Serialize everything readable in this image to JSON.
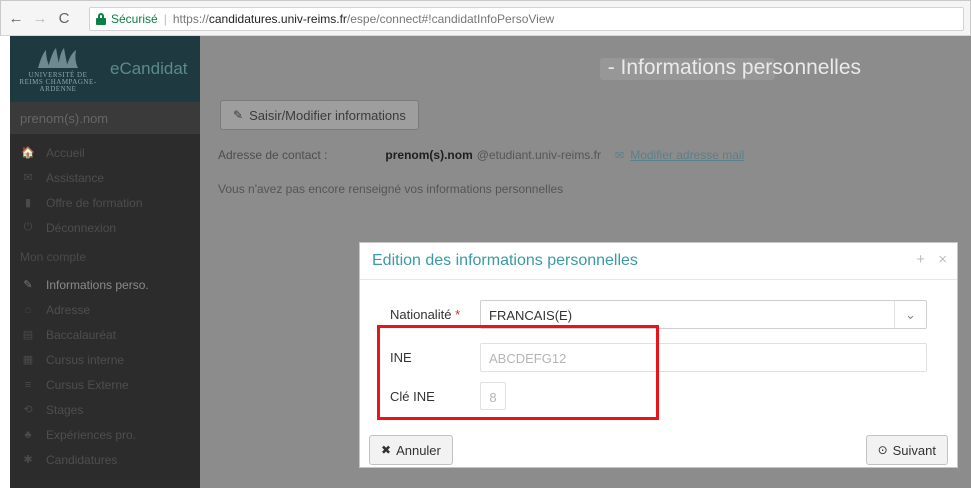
{
  "browser": {
    "back": "←",
    "forward": "→",
    "reload": "C",
    "secure_label": "Sécurisé",
    "url_proto": "https://",
    "url_host": "candidatures.univ-reims.fr",
    "url_path": "/espe/connect#!candidatInfoPersoView"
  },
  "app": {
    "brand": {
      "logo_text": "UNIVERSITÉ DE REIMS CHAMPAGNE-ARDENNE",
      "title": "eCandidat"
    },
    "user": "prenom(s).nom",
    "menu": [
      {
        "icon": "🏠",
        "icon_name": "home-icon",
        "label": "Accueil"
      },
      {
        "icon": "✉",
        "icon_name": "assistance-icon",
        "label": "Assistance"
      },
      {
        "icon": "▮",
        "icon_name": "bookmark-icon",
        "label": "Offre de formation"
      },
      {
        "icon": "⏻",
        "icon_name": "power-icon",
        "label": "Déconnexion"
      }
    ],
    "section_label": "Mon compte",
    "account_menu": [
      {
        "icon": "✎",
        "icon_name": "pencil-icon",
        "label": "Informations perso."
      },
      {
        "icon": "⌂",
        "icon_name": "address-icon",
        "label": "Adresse"
      },
      {
        "icon": "▤",
        "icon_name": "diploma-icon",
        "label": "Baccalauréat"
      },
      {
        "icon": "▦",
        "icon_name": "bank-icon",
        "label": "Cursus interne"
      },
      {
        "icon": "≡",
        "icon_name": "list-icon",
        "label": "Cursus Externe"
      },
      {
        "icon": "⟲",
        "icon_name": "cycle-icon",
        "label": "Stages"
      },
      {
        "icon": "♣",
        "icon_name": "people-icon",
        "label": "Expériences pro."
      },
      {
        "icon": "✱",
        "icon_name": "asterisk-icon",
        "label": "Candidatures"
      }
    ],
    "page_title": "- Informations personnelles",
    "edit_button": "Saisir/Modifier informations",
    "contact_label": "Adresse de contact :",
    "contact_name": "prenom(s).nom",
    "contact_domain": "@etudiant.univ-reims.fr",
    "modify_email_link": "Modifier adresse mail",
    "no_info_text": "Vous n'avez pas encore renseigné vos informations personnelles"
  },
  "modal": {
    "title": "Edition des informations personnelles",
    "maximize": "+",
    "close": "×",
    "nationality_label": "Nationalité",
    "required_marker": "*",
    "nationality_value": "FRANCAIS(E)",
    "ine_label": "INE",
    "ine_placeholder": "ABCDEFG12",
    "cle_label": "Clé INE",
    "cle_placeholder": "8",
    "cancel_label": "Annuler",
    "next_label": "Suivant"
  },
  "colors": {
    "highlight": "#e8141a",
    "modal_title": "#3a9aa5",
    "overlay_gray": "#8c8c8c",
    "sidebar": "#2c2c2c"
  }
}
